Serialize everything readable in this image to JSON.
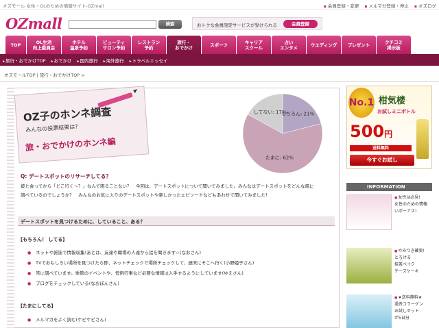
{
  "header": {
    "tagline": "オズモール 女性・OLのための情報サイト-OZmall",
    "links": [
      "会員登録・変更",
      "メルマガ登録・停止",
      "オズログ"
    ],
    "logo": "OZmall",
    "search_button": "検索",
    "member_text": "おトクな会員限定サービスが受けられる",
    "member_button": "会員登録"
  },
  "nav": {
    "tabs": [
      "TOP",
      "OL生活\n向上委員会",
      "ホテル\n温泉予約",
      "ビューティ\nサロン予約",
      "レストラン\n予約",
      "旅行・\nおでかけ",
      "スポーツ",
      "キャリア\nスクール",
      "占い\nエンタメ",
      "ウエディング",
      "プレゼント",
      "クチコミ\n掲示板"
    ],
    "active_index": 5
  },
  "subnav": [
    "旅行・おでかけTOP",
    "おでかけ",
    "国内旅行",
    "海外旅行",
    "トラベルエッセイ"
  ],
  "breadcrumb": [
    "オズモールTOP",
    "旅行・おでかけTOP"
  ],
  "survey": {
    "title_line1": "OZ子のホンネ調査",
    "title_line2": "みんなの投票結果は?",
    "title_line3": "旅・おでかけのホンネ編",
    "question": "Q: デートスポットのリサーチしてる？",
    "intro": "彼と会ってから「どこ行く〜？」なんて困ることない？　今回は、デートスポットについて聞いてみました。みんなはデートスポットをどんな風に調べているのでしょうか？　みんなのお気に入りのデートスポットや楽しかったエピソードなどもあわせて聞いてみました！",
    "section_title": "デートスポットを見つけるために、していること、ある？",
    "groups": [
      {
        "title": "【もちろん！ してる】",
        "items": [
          "ネットや雑誌で情報収集!あとは、友達や職場の人達から話を聞きます☆(なおさん)",
          "TVでおもしろい場所を見つけたら即、ネットチェックで場所チェックして、週末にそこへ行く(小野姫子さん)",
          "常に調べています。季節のイベントや、恒例行事など必要な情報は入手するようにしています(ゆえさん)",
          "ブログをチェックしている(なおぽんさん)"
        ]
      },
      {
        "title": "【たまにしてる】",
        "items": [
          "メルマガをよく読む(ケピケピさん)"
        ]
      }
    ]
  },
  "chart_data": {
    "type": "pie",
    "categories": [
      "たまに",
      "もちろん",
      "してない"
    ],
    "values": [
      62,
      21,
      17
    ],
    "labels": [
      "たまに: 62%",
      "もちろん: 21%",
      "してない: 17%"
    ],
    "colors": [
      "#c9a3b6",
      "#b3a6c4",
      "#d0d0d0"
    ]
  },
  "sidebar": {
    "ad1": {
      "badge": "No.1",
      "brand": "柑気楼",
      "subtitle": "お試しミニボトル",
      "price": "500",
      "yen": "円",
      "shipping": "送料無料",
      "cta": "今すぐお試し"
    },
    "info_title": "INFORMATION",
    "info": [
      {
        "lines": [
          "女性は必見!",
          "女性のための情報",
          "いボーナス!"
        ]
      },
      {
        "lines": [
          "やみつき確実!",
          "とろける",
          "抹茶ベイク",
          "チーズケーキ"
        ]
      },
      {
        "lines": [
          "★送料無料★",
          "過去コラーゲン",
          "お試しセット",
          "が5日分"
        ]
      }
    ]
  }
}
